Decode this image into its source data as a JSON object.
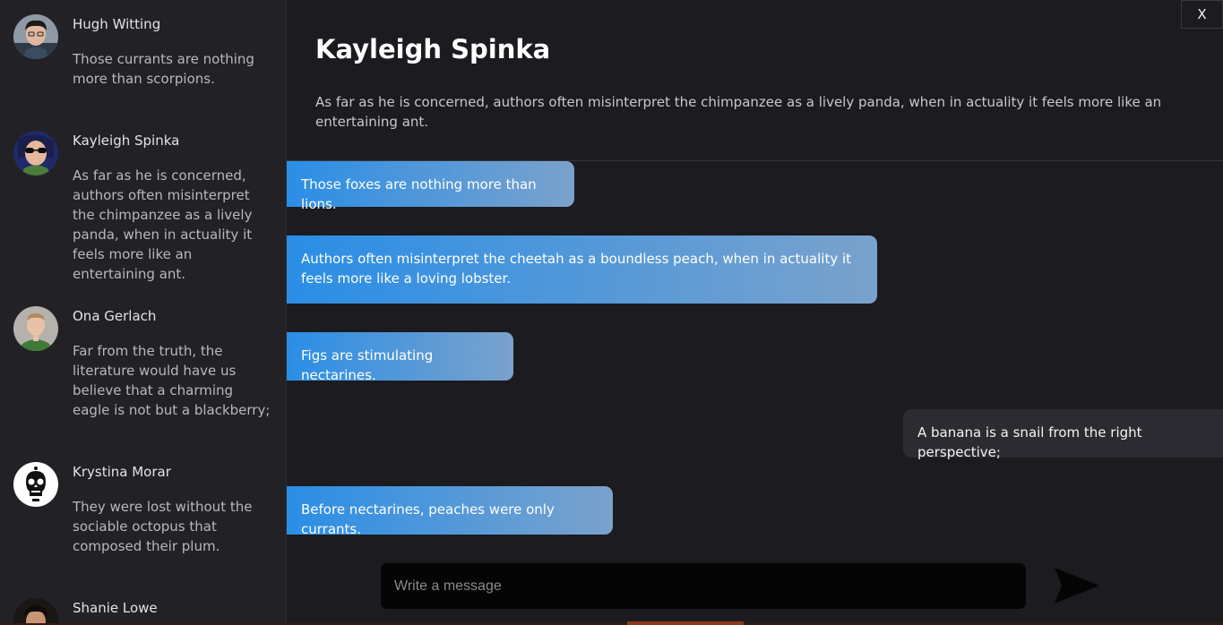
{
  "sidebar": {
    "contacts": [
      {
        "name": "Hugh Witting",
        "preview": "Those currants are nothing more than scorpions."
      },
      {
        "name": "Kayleigh Spinka",
        "preview": "As far as he is concerned, authors often misinterpret the chimpanzee as a lively panda, when in actuality it feels more like an entertaining ant."
      },
      {
        "name": "Ona Gerlach",
        "preview": "Far from the truth, the literature would have us believe that a charming eagle is not but a blackberry;"
      },
      {
        "name": "Krystina Morar",
        "preview": "They were lost without the sociable octopus that composed their plum."
      },
      {
        "name": "Shanie Lowe",
        "preview": ""
      }
    ]
  },
  "chat": {
    "close_label": "X",
    "title": "Kayleigh Spinka",
    "subtitle": "As far as he is concerned, authors often misinterpret the chimpanzee as a lively panda, when in actuality it feels more like an entertaining ant.",
    "messages": [
      {
        "direction": "in",
        "text": "Those foxes are nothing more than lions."
      },
      {
        "direction": "in",
        "text": "Authors often misinterpret the cheetah as a boundless peach, when in actuality it feels more like a loving lobster."
      },
      {
        "direction": "in",
        "text": "Figs are stimulating nectarines."
      },
      {
        "direction": "out",
        "text": "A banana is a snail from the right perspective;"
      },
      {
        "direction": "in",
        "text": "Before nectarines, peaches were only currants."
      }
    ],
    "composer": {
      "placeholder": "Write a message",
      "value": ""
    },
    "send_icon": "send-arrow-icon"
  },
  "colors": {
    "accent_gradient_start": "#2a8ee6",
    "accent_gradient_end": "#7aa2cc",
    "background": "#1c1b1f",
    "sidebar_background": "#222125",
    "outgoing_bubble": "#2c2b31"
  }
}
